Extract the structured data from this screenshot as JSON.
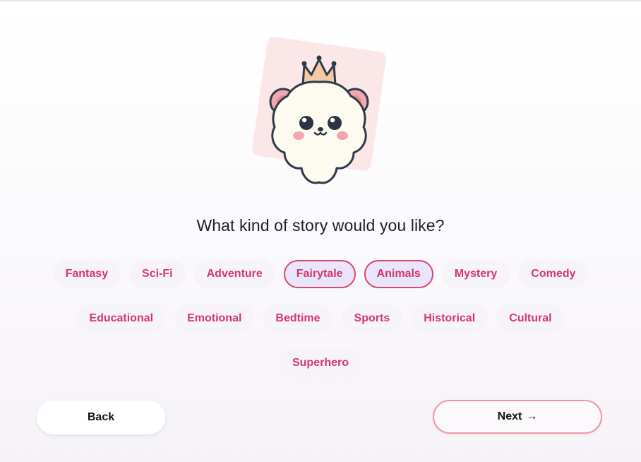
{
  "mascot": {
    "description_icon": "crowned-bear-mascot-icon"
  },
  "question": "What kind of story would you like?",
  "genres": {
    "rows": [
      [
        {
          "label": "Fantasy",
          "selected": false
        },
        {
          "label": "Sci-Fi",
          "selected": false
        },
        {
          "label": "Adventure",
          "selected": false
        },
        {
          "label": "Fairytale",
          "selected": true
        },
        {
          "label": "Animals",
          "selected": true
        },
        {
          "label": "Mystery",
          "selected": false
        },
        {
          "label": "Comedy",
          "selected": false
        }
      ],
      [
        {
          "label": "Educational",
          "selected": false
        },
        {
          "label": "Emotional",
          "selected": false
        },
        {
          "label": "Bedtime",
          "selected": false
        },
        {
          "label": "Sports",
          "selected": false
        },
        {
          "label": "Historical",
          "selected": false
        },
        {
          "label": "Cultural",
          "selected": false
        }
      ],
      [
        {
          "label": "Superhero",
          "selected": false
        }
      ]
    ]
  },
  "nav": {
    "back_label": "Back",
    "next_label": "Next",
    "next_icon": "→"
  },
  "colors": {
    "accent_pink": "#d6366f",
    "selected_bg": "#e9e6fb",
    "next_border": "#ea9aa6"
  }
}
